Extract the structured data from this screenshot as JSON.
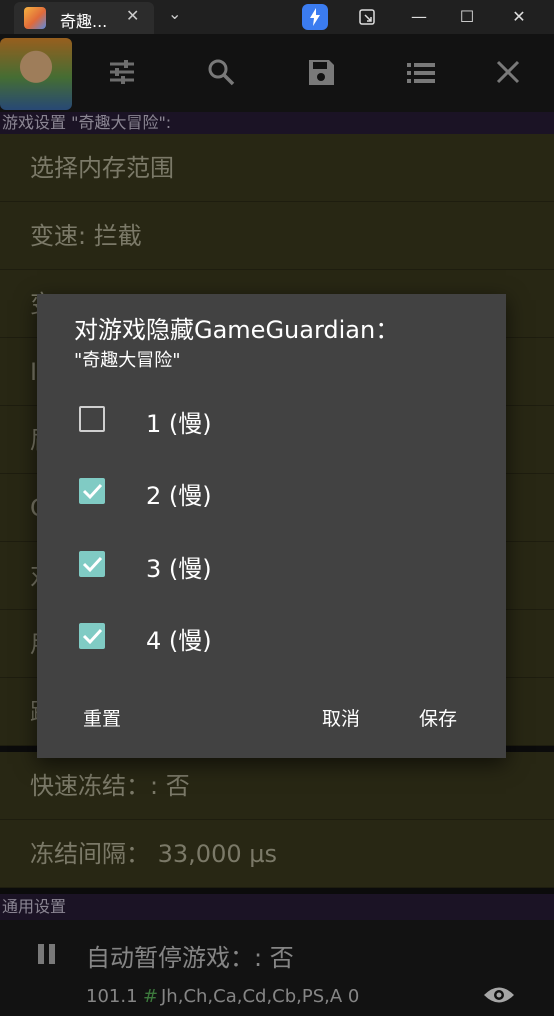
{
  "window": {
    "tab_title": "奇趣...",
    "close_glyph": "✕",
    "dropdown_glyph": "⌄",
    "minimize_glyph": "—",
    "maximize_glyph": "☐",
    "window_close_glyph": "✕",
    "accent": "#3b7cf0"
  },
  "toolbar": {
    "icons": [
      "tune-icon",
      "search-icon",
      "save-icon",
      "list-icon",
      "close-icon"
    ]
  },
  "settings": {
    "section_game": "游戏设置 \"奇趣大冒险\":",
    "rows": [
      "选择内存范围",
      "变速: 拦截",
      "变",
      "I",
      "届",
      "C",
      "对",
      "用",
      "跳",
      "快速冻结：: 否",
      "冻结间隔： 33,000 µs"
    ],
    "section_general": "通用设置"
  },
  "bottom": {
    "pause_setting": "自动暂停游戏：: 否",
    "status_prefix": "101.1",
    "status_hash": "#",
    "status_text": "Jh,Ch,Ca,Cd,Cb,PS,A 0"
  },
  "dialog": {
    "title": "对游戏隐藏GameGuardian：",
    "subtitle": "\"奇趣大冒险\"",
    "options": [
      {
        "label": "1 (慢)",
        "checked": false
      },
      {
        "label": "2 (慢)",
        "checked": true
      },
      {
        "label": "3 (慢)",
        "checked": true
      },
      {
        "label": "4 (慢)",
        "checked": true
      }
    ],
    "reset_label": "重置",
    "cancel_label": "取消",
    "save_label": "保存",
    "checkbox_color": "#80cbc4"
  }
}
